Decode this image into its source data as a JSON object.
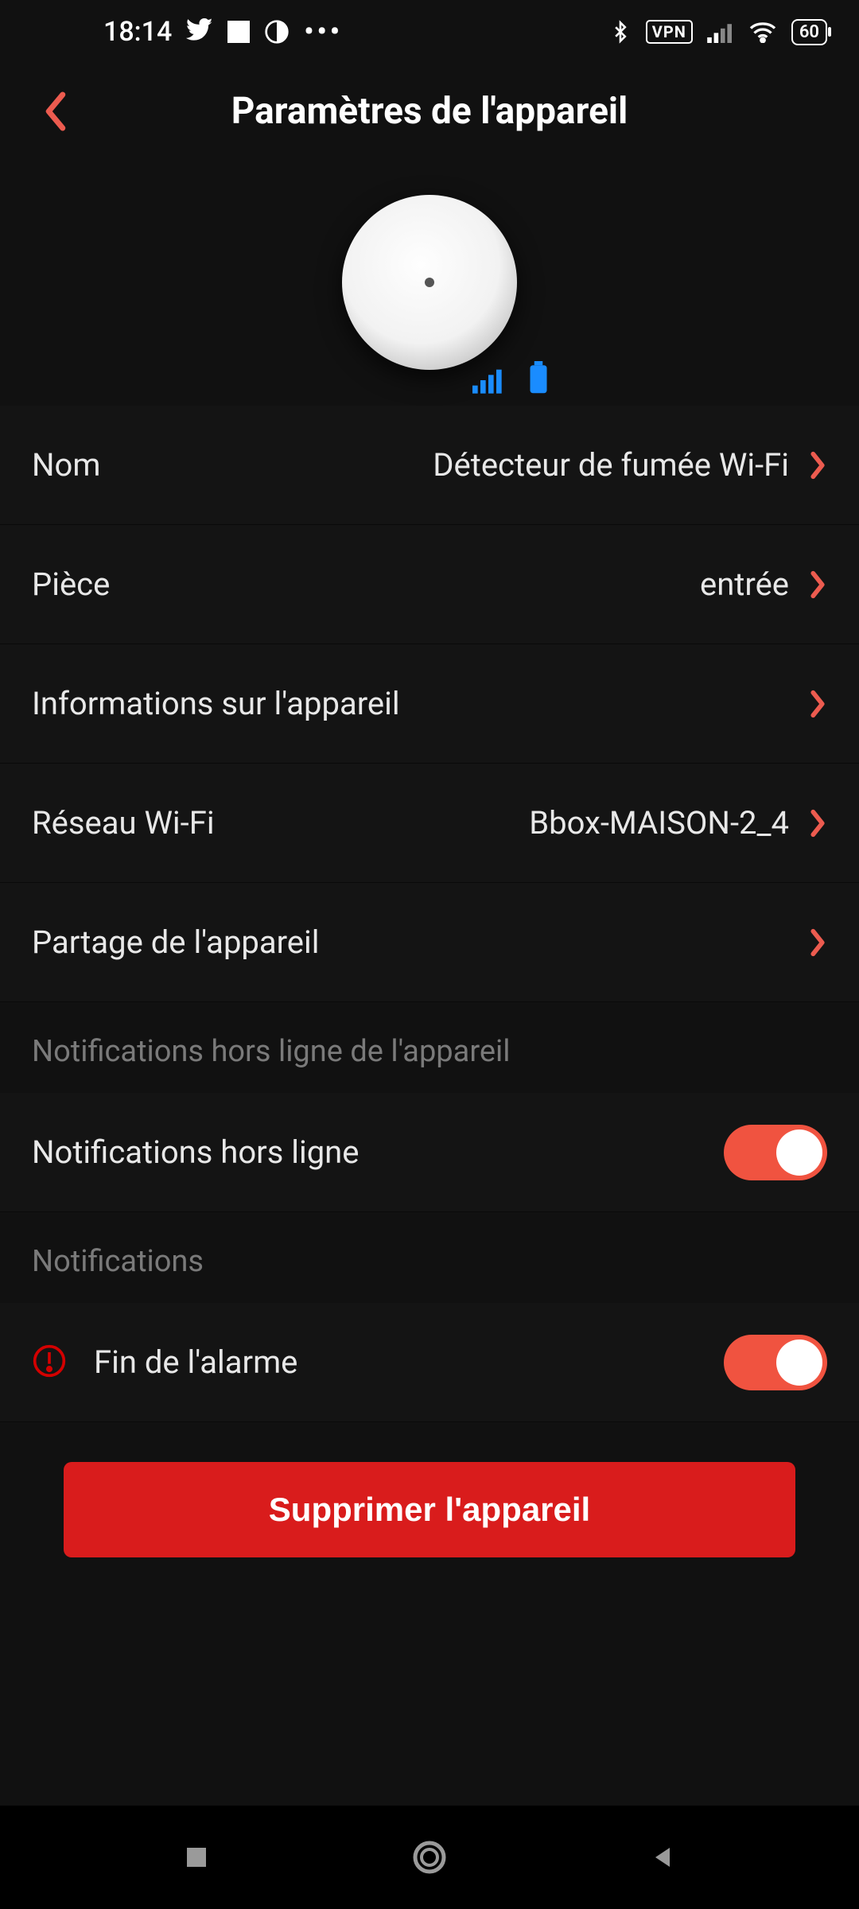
{
  "status": {
    "time": "18:14",
    "vpn": "VPN",
    "battery": "60"
  },
  "header": {
    "title": "Paramètres de l'appareil"
  },
  "rows": {
    "name": {
      "label": "Nom",
      "value": "Détecteur de fumée Wi-Fi"
    },
    "room": {
      "label": "Pièce",
      "value": "entrée"
    },
    "info": {
      "label": "Informations sur l'appareil"
    },
    "wifi": {
      "label": "Réseau Wi-Fi",
      "value": "Bbox-MAISON-2_4"
    },
    "share": {
      "label": "Partage de l'appareil"
    }
  },
  "sections": {
    "offline_header": "Notifications hors ligne de l'appareil",
    "offline_toggle_label": "Notifications hors ligne",
    "notifications_header": "Notifications",
    "alarm_end_label": "Fin de l'alarme"
  },
  "toggles": {
    "offline": true,
    "alarm_end": true
  },
  "delete": {
    "label": "Supprimer l'appareil"
  },
  "colors": {
    "accent": "#ec5b4f",
    "danger": "#d91c1c",
    "signal": "#1a8cff"
  }
}
